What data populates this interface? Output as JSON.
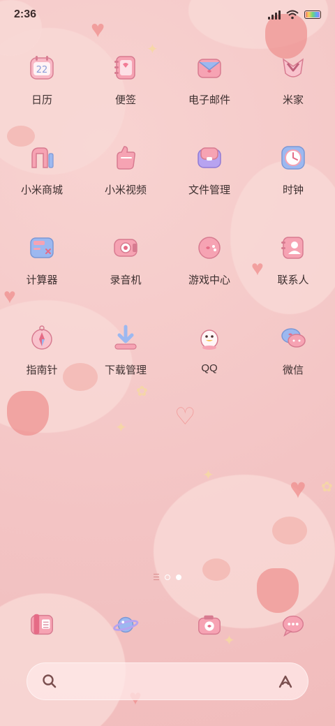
{
  "status": {
    "time": "2:36"
  },
  "apps": [
    {
      "label": "日历",
      "icon": "calendar-icon",
      "day": "22"
    },
    {
      "label": "便签",
      "icon": "notes-icon"
    },
    {
      "label": "电子邮件",
      "icon": "email-icon"
    },
    {
      "label": "米家",
      "icon": "mijia-icon"
    },
    {
      "label": "小米商城",
      "icon": "mi-store-icon"
    },
    {
      "label": "小米视频",
      "icon": "mi-video-icon"
    },
    {
      "label": "文件管理",
      "icon": "file-manager-icon"
    },
    {
      "label": "时钟",
      "icon": "clock-icon"
    },
    {
      "label": "计算器",
      "icon": "calculator-icon"
    },
    {
      "label": "录音机",
      "icon": "recorder-icon"
    },
    {
      "label": "游戏中心",
      "icon": "game-center-icon"
    },
    {
      "label": "联系人",
      "icon": "contacts-icon"
    },
    {
      "label": "指南针",
      "icon": "compass-icon"
    },
    {
      "label": "下载管理",
      "icon": "downloads-icon"
    },
    {
      "label": "QQ",
      "icon": "qq-icon"
    },
    {
      "label": "微信",
      "icon": "wechat-icon"
    }
  ],
  "dock": [
    {
      "icon": "phone-icon"
    },
    {
      "icon": "browser-planet-icon"
    },
    {
      "icon": "camera-icon"
    },
    {
      "icon": "messages-icon"
    }
  ],
  "search": {
    "placeholder": ""
  },
  "colors": {
    "background": "#f4c6c6",
    "icon_pink": "#f6a3b3",
    "icon_blue": "#9cb8f0",
    "icon_purple": "#b7a3f0",
    "text": "#3e3030"
  }
}
